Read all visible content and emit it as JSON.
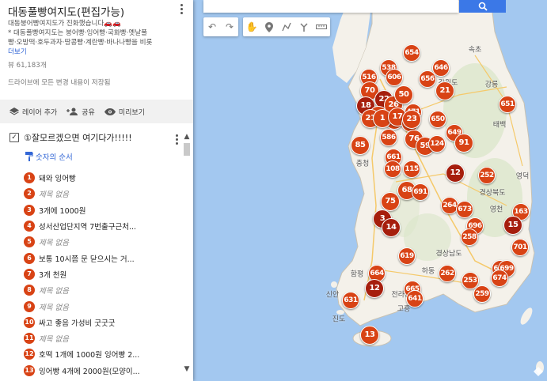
{
  "map": {
    "land_color": "#f4f1ea",
    "water_color": "#a3c8f0",
    "pin_color": "#d84315",
    "pin_color_dark": "#a61e0d",
    "labels": [
      {
        "text": "속초",
        "dark": false
      },
      {
        "text": "강릉",
        "dark": false
      },
      {
        "text": "태백",
        "dark": false
      },
      {
        "text": "강원도",
        "dark": false
      },
      {
        "text": "영덕",
        "dark": false
      },
      {
        "text": "경상북도",
        "dark": false
      },
      {
        "text": "영천",
        "dark": false
      },
      {
        "text": "경상남도",
        "dark": false
      },
      {
        "text": "함평",
        "dark": false
      },
      {
        "text": "하동",
        "dark": false
      },
      {
        "text": "고흥",
        "dark": false
      },
      {
        "text": "신안",
        "dark": false
      },
      {
        "text": "진도",
        "dark": false
      },
      {
        "text": "전라남도",
        "dark": false
      },
      {
        "text": "충청",
        "dark": false
      }
    ],
    "pins": [
      "654",
      "538",
      "646",
      "516",
      "606",
      "656",
      "70",
      "21",
      "18",
      "22",
      "26",
      "4",
      "2",
      "50",
      "21",
      "1",
      "17",
      "471",
      "581",
      "650",
      "651",
      "23",
      "586",
      "649",
      "85",
      "76",
      "59",
      "124",
      "91",
      "661",
      "108",
      "115",
      "12",
      "252",
      "75",
      "68",
      "691",
      "264",
      "673",
      "163",
      "3",
      "14",
      "696",
      "258",
      "15",
      "619",
      "701",
      "624",
      "699",
      "674",
      "664",
      "12",
      "262",
      "253",
      "665",
      "641",
      "631",
      "259",
      "13"
    ]
  },
  "toolbar": {
    "tools": [
      "undo-icon",
      "redo-icon",
      "pan-hand-icon",
      "marker-icon",
      "draw-line-icon",
      "directions-icon",
      "ruler-icon"
    ]
  },
  "panel": {
    "title": "대동풀빵여지도(편집가능)",
    "desc_line1": "대동붕어빵여지도가 진화했습니다🚗🚗",
    "desc_line2": "* 대동풀빵여지도는 붕어빵·잉어빵·국화빵·옛날풀",
    "desc_line3": "빵·오방떡·호두과자·땅콩빵·계란빵·바나나빵을 비롯",
    "more": "더보기",
    "views": "뷰 61,183개",
    "saved": "드라이브에 모든 변경 내용이 저장됨",
    "actions": {
      "add_layer": "레이어 추가",
      "share": "공유",
      "preview": "미리보기"
    },
    "layer": {
      "title": "①잘모르겠으면 여기다가!!!!!",
      "order_label": "숫자의 순서"
    },
    "items": [
      {
        "num": "1",
        "label": "돼와 잉어빵",
        "untitled": false
      },
      {
        "num": "2",
        "label": "제목 없음",
        "untitled": true
      },
      {
        "num": "3",
        "label": "3개에 1000원",
        "untitled": false
      },
      {
        "num": "4",
        "label": "성서산업단지역 7번출구근처...",
        "untitled": false
      },
      {
        "num": "5",
        "label": "제목 없음",
        "untitled": true
      },
      {
        "num": "6",
        "label": "보통 10시쯤 문 닫으시는 거...",
        "untitled": false
      },
      {
        "num": "7",
        "label": "3개 천원",
        "untitled": false
      },
      {
        "num": "8",
        "label": "제목 없음",
        "untitled": true
      },
      {
        "num": "9",
        "label": "제목 없음",
        "untitled": true
      },
      {
        "num": "10",
        "label": "싸고 좋음 가성비 굿굿굿",
        "untitled": false
      },
      {
        "num": "11",
        "label": "제목 없음",
        "untitled": true
      },
      {
        "num": "12",
        "label": "호떡 1개에 1000원  잉어빵 2...",
        "untitled": false
      },
      {
        "num": "13",
        "label": "잉어빵 4개에 2000원(모양이...",
        "untitled": false
      }
    ]
  }
}
